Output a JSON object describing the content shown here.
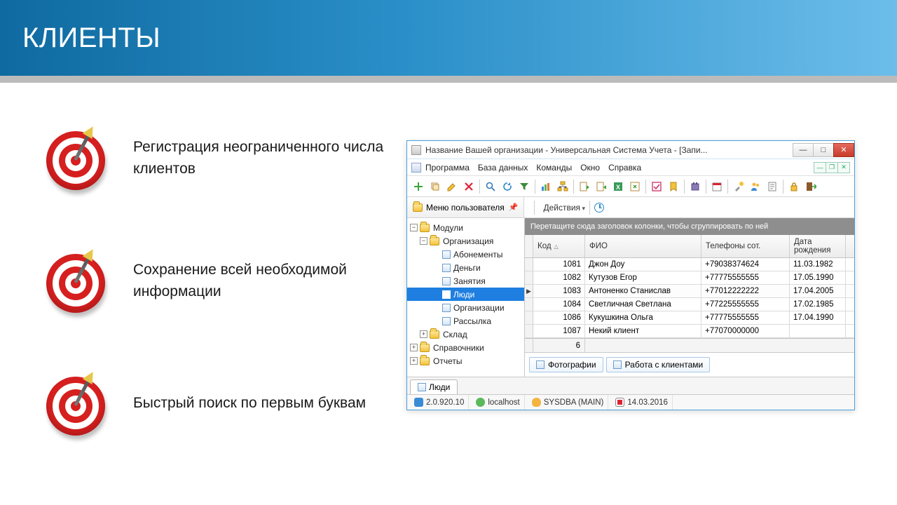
{
  "slide": {
    "title": "КЛИЕНТЫ",
    "bullets": [
      "Регистрация неограниченного числа клиентов",
      "Сохранение всей необходимой информации",
      "Быстрый поиск по первым буквам"
    ]
  },
  "app": {
    "window_title": "Название Вашей организации - Универсальная Система Учета - [Запи...",
    "menus": [
      "Программа",
      "База данных",
      "Команды",
      "Окно",
      "Справка"
    ],
    "user_menu_label": "Меню пользователя",
    "actions_label": "Действия",
    "tree": {
      "root": "Модули",
      "org": "Организация",
      "org_children": [
        "Абонементы",
        "Деньги",
        "Занятия",
        "Люди",
        "Организации",
        "Рассылка"
      ],
      "selected": "Люди",
      "warehouse": "Склад",
      "refs": "Справочники",
      "reports": "Отчеты"
    },
    "grid": {
      "group_hint": "Перетащите сюда заголовок колонки, чтобы сгруппировать по ней",
      "columns": {
        "code": "Код",
        "fio": "ФИО",
        "tel": "Телефоны сот.",
        "dob": "Дата рождения"
      },
      "rows": [
        {
          "code": "1081",
          "fio": "Джон Доу",
          "tel": "+79038374624",
          "dob": "11.03.1982"
        },
        {
          "code": "1082",
          "fio": "Кутузов Егор",
          "tel": "+77775555555",
          "dob": "17.05.1990"
        },
        {
          "code": "1083",
          "fio": "Антоненко Станислав",
          "tel": "+77012222222",
          "dob": "17.04.2005"
        },
        {
          "code": "1084",
          "fio": "Светличная Светлана",
          "tel": "+77225555555",
          "dob": "17.02.1985"
        },
        {
          "code": "1086",
          "fio": "Кукушкина Ольга",
          "tel": "+77775555555",
          "dob": "17.04.1990"
        },
        {
          "code": "1087",
          "fio": "Некий клиент",
          "tel": "+77070000000",
          "dob": ""
        }
      ],
      "current_row_index": 2,
      "footer_count": "6"
    },
    "sub_tabs": [
      "Фотографии",
      "Работа с клиентами"
    ],
    "doc_tab": "Люди",
    "status": {
      "version": "2.0.920.10",
      "host": "localhost",
      "user": "SYSDBA (MAIN)",
      "date": "14.03.2016"
    }
  }
}
